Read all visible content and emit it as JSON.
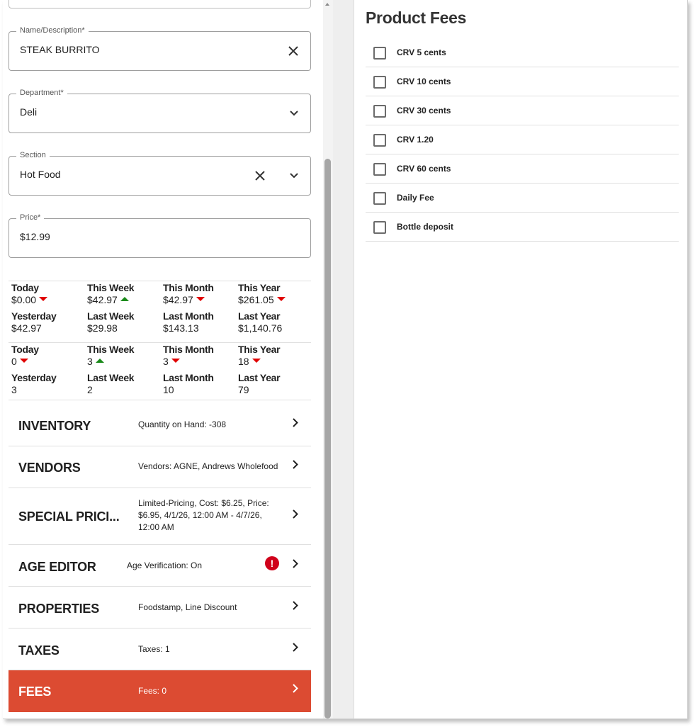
{
  "fields": {
    "name": {
      "label": "Name/Description*",
      "value": "STEAK BURRITO"
    },
    "department": {
      "label": "Department*",
      "value": "Deli"
    },
    "section": {
      "label": "Section",
      "value": "Hot Food"
    },
    "price": {
      "label": "Price*",
      "value": "$12.99"
    }
  },
  "sales_stats": [
    {
      "header": "Today",
      "value": "$0.00",
      "trend": "down"
    },
    {
      "header": "This Week",
      "value": "$42.97",
      "trend": "up"
    },
    {
      "header": "This Month",
      "value": "$42.97",
      "trend": "down"
    },
    {
      "header": "This Year",
      "value": "$261.05",
      "trend": "down"
    },
    {
      "header": "Yesterday",
      "value": "$42.97"
    },
    {
      "header": "Last Week",
      "value": "$29.98"
    },
    {
      "header": "Last Month",
      "value": "$143.13"
    },
    {
      "header": "Last Year",
      "value": "$1,140.76"
    }
  ],
  "qty_stats": [
    {
      "header": "Today",
      "value": "0",
      "trend": "down"
    },
    {
      "header": "This Week",
      "value": "3",
      "trend": "up"
    },
    {
      "header": "This Month",
      "value": "3",
      "trend": "down"
    },
    {
      "header": "This Year",
      "value": "18",
      "trend": "down"
    },
    {
      "header": "Yesterday",
      "value": "3"
    },
    {
      "header": "Last Week",
      "value": "2"
    },
    {
      "header": "Last Month",
      "value": "10"
    },
    {
      "header": "Last Year",
      "value": "79"
    }
  ],
  "sections": [
    {
      "title": "INVENTORY",
      "summary": "Quantity on Hand: -308"
    },
    {
      "title": "VENDORS",
      "summary": "Vendors: AGNE, Andrews Wholefood"
    },
    {
      "title": "SPECIAL PRICI...",
      "summary": "Limited-Pricing, Cost: $6.25, Price: $6.95, 4/1/26, 12:00 AM - 4/7/26, 12:00 AM"
    },
    {
      "title": "AGE EDITOR",
      "summary": "Age Verification: On",
      "alert": "!"
    },
    {
      "title": "PROPERTIES",
      "summary": "Foodstamp, Line Discount"
    },
    {
      "title": "TAXES",
      "summary": "Taxes: 1"
    },
    {
      "title": "FEES",
      "summary": "Fees: 0",
      "active": true
    }
  ],
  "product_fees": {
    "title": "Product Fees",
    "items": [
      {
        "label": "CRV 5 cents",
        "checked": false
      },
      {
        "label": "CRV 10 cents",
        "checked": false
      },
      {
        "label": "CRV 30 cents",
        "checked": false
      },
      {
        "label": "CRV 1.20",
        "checked": false
      },
      {
        "label": "CRV 60 cents",
        "checked": false
      },
      {
        "label": "Daily Fee",
        "checked": false
      },
      {
        "label": "Bottle deposit",
        "checked": false
      }
    ]
  },
  "colors": {
    "active_row": "#dc4b32",
    "trend_down": "#e00000",
    "trend_up": "#1a8a1a",
    "alert_badge": "#d0021b"
  },
  "icons": {
    "clear": "close-icon",
    "dropdown": "chevron-down-icon",
    "row_nav": "chevron-right-icon",
    "trend_up": "triangle-up-icon",
    "trend_down": "triangle-down-icon",
    "alert": "exclamation-icon"
  }
}
